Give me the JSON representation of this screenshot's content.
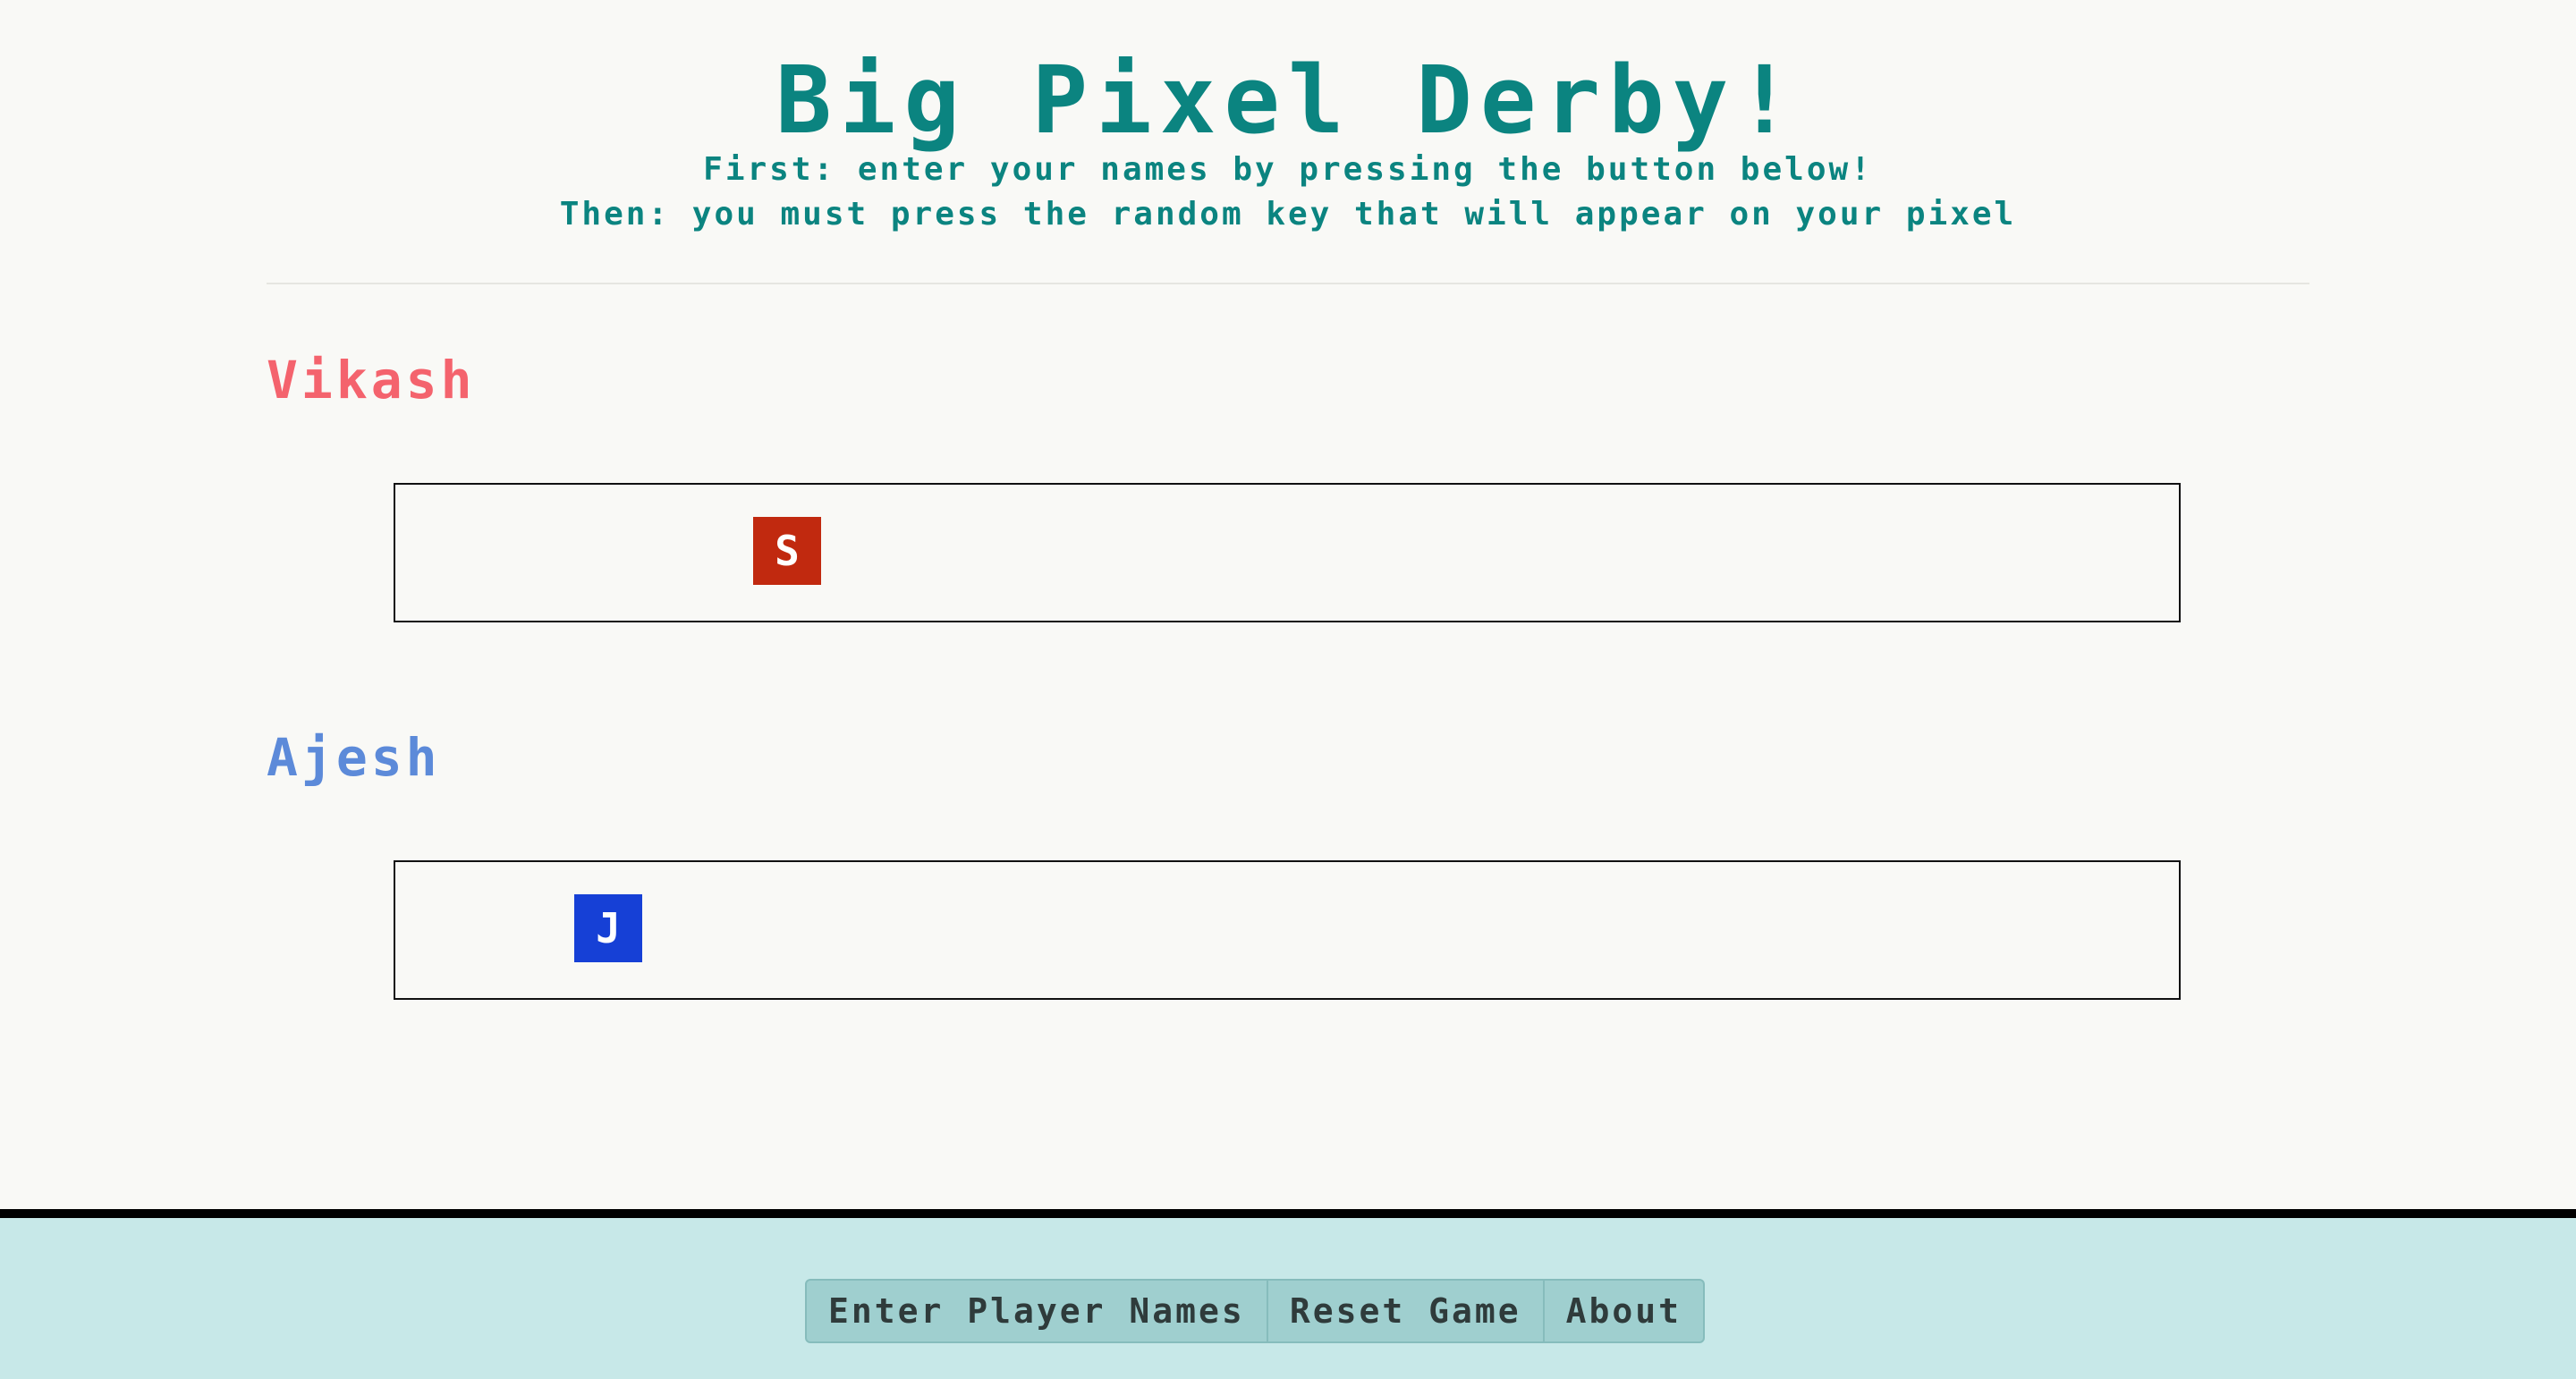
{
  "header": {
    "title": "Big Pixel Derby!",
    "instruction_1": "First: enter your names by pressing the button below!",
    "instruction_2": "Then: you must press the random key that will appear on your pixel"
  },
  "players": [
    {
      "name": "Vikash",
      "color": "#f4636d",
      "pixel_key": "S",
      "pixel_color": "#c1290f"
    },
    {
      "name": "Ajesh",
      "color": "#5c8ad9",
      "pixel_key": "J",
      "pixel_color": "#1640d6"
    }
  ],
  "footer": {
    "buttons": [
      {
        "label": "Enter Player Names"
      },
      {
        "label": "Reset Game"
      },
      {
        "label": "About"
      }
    ]
  },
  "colors": {
    "title": "#0b8480",
    "background": "#f9f9f6",
    "footer": "#c7e8e8"
  }
}
